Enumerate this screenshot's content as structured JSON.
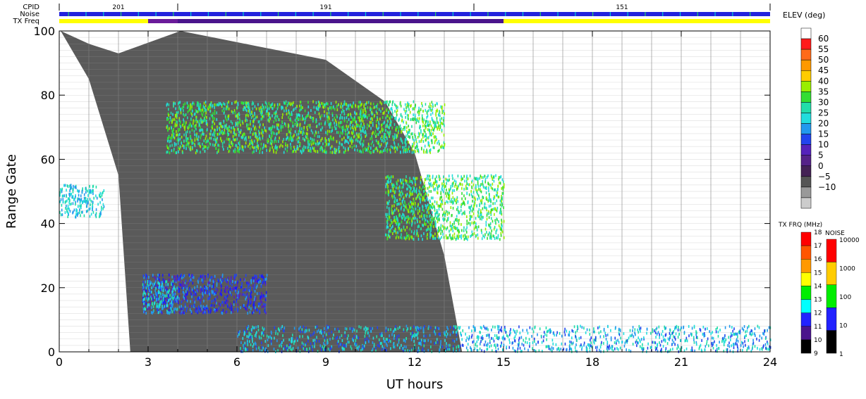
{
  "header": {
    "cpid_label": "CPID",
    "noise_label": "Noise",
    "txfreq_label": "TX Freq",
    "cpid_segments": [
      {
        "start": 0,
        "end": 4,
        "label": "201"
      },
      {
        "start": 4,
        "end": 14,
        "label": "191"
      },
      {
        "start": 14,
        "end": 24,
        "label": "151"
      }
    ],
    "txfreq_segments": [
      {
        "start": 0,
        "end": 3,
        "color": "#ffff00"
      },
      {
        "start": 3,
        "end": 4,
        "color": "#6a1b9a"
      },
      {
        "start": 4,
        "end": 15,
        "color": "#4a148c"
      },
      {
        "start": 15,
        "end": 24,
        "color": "#ffff00"
      }
    ],
    "noise_color": "#2222dd"
  },
  "chart_data": {
    "type": "heatmap",
    "xlabel": "UT hours",
    "ylabel": "Range Gate",
    "xlim": [
      0,
      24
    ],
    "ylim": [
      0,
      100
    ],
    "x_ticks": [
      "0",
      "3",
      "6",
      "9",
      "12",
      "15",
      "18",
      "21",
      "24"
    ],
    "y_ticks": [
      "0",
      "20",
      "40",
      "60",
      "80",
      "100"
    ],
    "ground_scatter_color": "#5a5a5a",
    "ground_scatter_region": {
      "upper_edge_x": [
        [
          0,
          100
        ],
        [
          1,
          96
        ],
        [
          2,
          93
        ],
        [
          4,
          100
        ]
      ],
      "lower_edge_x": [
        [
          0.05,
          100
        ],
        [
          1,
          85
        ],
        [
          2,
          55
        ],
        [
          2.4,
          0
        ]
      ],
      "right_edge_x": [
        [
          4.1,
          100
        ],
        [
          9,
          91
        ],
        [
          11,
          78
        ],
        [
          12,
          62
        ],
        [
          13,
          30
        ],
        [
          13.6,
          0
        ]
      ]
    },
    "scatter_regions": [
      {
        "name": "band-mid",
        "x": [
          3.6,
          13
        ],
        "y": [
          62,
          78
        ],
        "elev": 32
      },
      {
        "name": "tail",
        "x": [
          11,
          15
        ],
        "y": [
          35,
          55
        ],
        "elev": 30
      },
      {
        "name": "morning",
        "x": [
          0,
          1.5
        ],
        "y": [
          42,
          52
        ],
        "elev": 28
      },
      {
        "name": "blob-low",
        "x": [
          2.8,
          7
        ],
        "y": [
          12,
          24
        ],
        "elev": 15
      },
      {
        "name": "blob-cyan",
        "x": [
          2.8,
          4
        ],
        "y": [
          12,
          22
        ],
        "elev": 24
      },
      {
        "name": "near-range",
        "x": [
          6,
          24
        ],
        "y": [
          0,
          8
        ],
        "elev": 20
      }
    ],
    "elev_colorbar": {
      "title": "ELEV (deg)",
      "labels": [
        "60",
        "55",
        "50",
        "45",
        "40",
        "35",
        "30",
        "25",
        "20",
        "15",
        "10",
        "5",
        "0",
        "−5",
        "−10"
      ],
      "colors": [
        "#ffffff",
        "#ff1a1a",
        "#ff6a1a",
        "#ff9900",
        "#ffcc00",
        "#99ee00",
        "#33dd33",
        "#22ddaa",
        "#22dddd",
        "#2299ee",
        "#2244ee",
        "#5522bb",
        "#552288",
        "#442255",
        "#555555",
        "#999999",
        "#cccccc"
      ]
    },
    "txfrq_colorbar": {
      "title": "TX FRQ (MHz)",
      "labels": [
        "18",
        "17",
        "16",
        "15",
        "14",
        "13",
        "12",
        "11",
        "10",
        "9"
      ],
      "colors": [
        "#ff0000",
        "#ff5500",
        "#ff9900",
        "#ffff00",
        "#00ee00",
        "#00ffff",
        "#2222ff",
        "#4a148c",
        "#000000"
      ]
    },
    "noise_colorbar": {
      "title": "NOISE",
      "labels": [
        "10000",
        "1000",
        "100",
        "10",
        "1"
      ],
      "colors": [
        "#ff0000",
        "#ffcc00",
        "#00ee00",
        "#2222ff",
        "#000000"
      ]
    }
  }
}
